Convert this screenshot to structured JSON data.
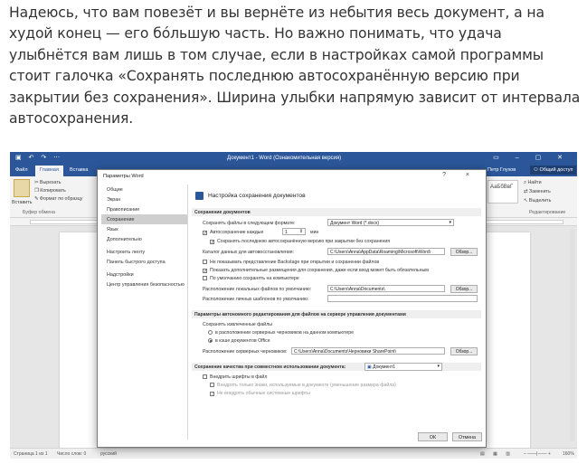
{
  "article": {
    "paragraph": "Надеюсь, что вам повезёт и вы вернёте из небытия весь документ, а на худой конец — его бóльшую часть. Но важно понимать, что удача улыбнётся вам лишь в том случае, если в настройках самой программы стоит галочка «Сохранять последнюю автосохранённую версию при закрытии без сохранения». Ширина улыбки напрямую зависит от интервала автосохранения."
  },
  "word": {
    "window_title": "Документ1 - Word (Ознакомительная версия)",
    "tabs": [
      "Файл",
      "Главная",
      "Вставка"
    ],
    "active_tab": "Главная",
    "user": "Петр Глухов",
    "share": "Общий доступ",
    "ribbon": {
      "paste": "Вставить",
      "cut": "Вырезать",
      "copy": "Копировать",
      "format_painter": "Формат по образцу",
      "clipboard_group": "Буфер обмена",
      "style_sample": "АаБбВвГ",
      "find": "Найти",
      "replace": "Заменить",
      "select": "Выделить",
      "editing_group": "Редактирование"
    },
    "status": {
      "page": "Страница 1 из 1",
      "words": "Число слов: 0",
      "language": "русский",
      "zoom": "160%"
    }
  },
  "dialog": {
    "title": "Параметры Word",
    "controls": "? ×",
    "nav": [
      "Общие",
      "Экран",
      "Правописание",
      "Сохранение",
      "Язык",
      "Дополнительно",
      "Настроить ленту",
      "Панель быстрого доступа",
      "Надстройки",
      "Центр управления безопасностью"
    ],
    "nav_active_index": 3,
    "header": "Настройка сохранения документов",
    "save_section": {
      "title": "Сохранение документов",
      "format_label": "Сохранять файлы в следующем формате:",
      "format_value": "Документ Word (*.docx)",
      "autosave_label": "Автосохранение каждые",
      "autosave_value": "1",
      "autosave_unit": "мин",
      "keep_last_label": "Сохранять последнюю автосохранённую версию при закрытии без сохранения",
      "autorecover_label": "Каталог данных для автовосстановления:",
      "autorecover_path": "C:\\Users\\Anna\\AppData\\Roaming\\Microsoft\\Word\\",
      "browse": "Обзор...",
      "backstage_label": "Не показывать представление Backstage при открытии и сохранении файлов",
      "show_additional_label": "Показать дополнительные размещения для сохранения, даже если вход может быть обязательным",
      "default_computer_label": "По умолчанию сохранять на компьютере",
      "local_files_label": "Расположение локальных файлов по умолчанию:",
      "local_files_path": "C:\\Users\\Anna\\Documents\\",
      "templates_label": "Расположение личных шаблонов по умолчанию:",
      "templates_path": ""
    },
    "offline_section": {
      "title": "Параметры автономного редактирования для файлов на сервере управления документами",
      "save_checked_out": "Сохранять извлеченные файлы",
      "opt_server": "в расположении серверных черновиков на данном компьютере",
      "opt_cache": "в кэше документов Office",
      "drafts_label": "Расположение серверных черновиков:",
      "drafts_path": "C:\\Users\\Anna\\Documents\\Черновики SharePoint\\",
      "browse": "Обзор..."
    },
    "fidelity_section": {
      "title": "Сохранение качества при совместном использовании документа:",
      "document": "Документ1",
      "embed_fonts": "Внедрить шрифты в файл",
      "embed_used_only": "Внедрять только знаки, используемые в документе (уменьшение размера файла)",
      "no_common_fonts": "Не внедрять обычные системные шрифты"
    },
    "ok": "ОК",
    "cancel": "Отмена"
  }
}
